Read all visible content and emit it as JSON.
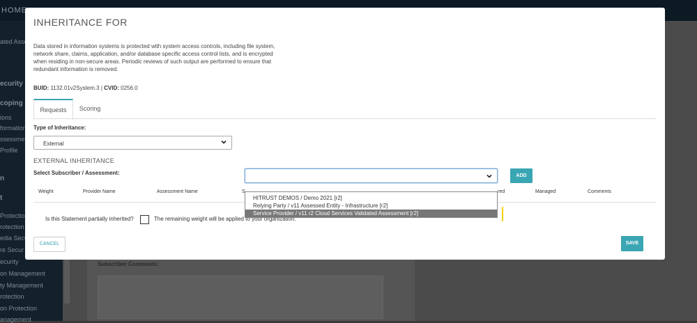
{
  "background": {
    "home_label": "HOME",
    "sidebar_items": [
      "ated Asse",
      "ecurity",
      "coping",
      "ions",
      "formation",
      "ssessmen",
      "Profile",
      "n",
      "t",
      "Protectio",
      "rotection",
      "edia Secu",
      "re Secur",
      "ecurity",
      "on Management",
      "ty Management",
      "rotection",
      "on Protection",
      "anagement"
    ],
    "subscriber_comments_label": "Subscriber Comments:"
  },
  "modal": {
    "title": "INHERITANCE FOR",
    "description": "Data stored in information systems is protected with system access controls, including file system, network share, claims, application, and/or database specific access control lists, and is encrypted when residing in non-secure areas. Periodic reviews of such output are performed to ensure that redundant information is removed.",
    "buid_label": "BUID:",
    "buid_value": "1132.01v2System.3",
    "separator": "|",
    "cvid_label": "CVID:",
    "cvid_value": "0256.0",
    "tabs": [
      {
        "label": "Requests",
        "active": true
      },
      {
        "label": "Scoring",
        "active": false
      }
    ],
    "type_label": "Type of Inheritance:",
    "type_value": "External",
    "section_title": "EXTERNAL INHERITANCE",
    "subscriber_label": "Select Subscriber / Assessment:",
    "subscriber_value": "",
    "add_label": "ADD",
    "columns": [
      "Weight",
      "Provider Name",
      "Assessment Name",
      "S",
      "red",
      "Managed",
      "Comments"
    ],
    "dropdown_options": [
      {
        "label": "HITRUST DEMOS / Demo 2021 [r2]",
        "highlighted": false
      },
      {
        "label": "Relying Party / v11 Assessed Entity - Infrastructure [r2]",
        "highlighted": false
      },
      {
        "label": "Service Provider / v11 r2 Cloud Services Validated Assessment [r2]",
        "highlighted": true
      }
    ],
    "partial_label": "Is this Statement partially inherited?",
    "remaining_label": "The remaining weight will be applied to your organization.",
    "cancel_label": "CANCEL",
    "save_label": "SAVE"
  },
  "colors": {
    "accent": "#3aa6b3",
    "overlay": "#3a3a3a",
    "highlight": "#777777"
  }
}
